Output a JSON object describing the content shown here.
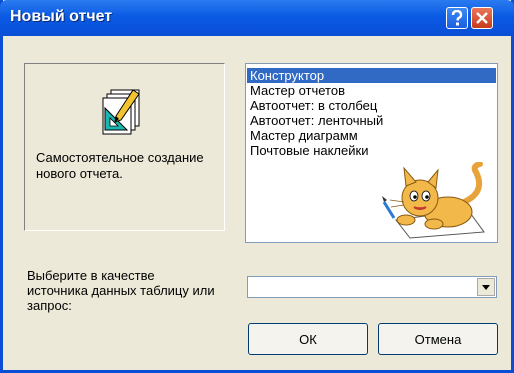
{
  "window": {
    "title": "Новый отчет"
  },
  "preview": {
    "description": "Самостоятельное создание нового отчета."
  },
  "list": {
    "items": [
      {
        "label": "Конструктор",
        "selected": true
      },
      {
        "label": "Мастер отчетов",
        "selected": false
      },
      {
        "label": "Автоотчет: в столбец",
        "selected": false
      },
      {
        "label": "Автоотчет: ленточный",
        "selected": false
      },
      {
        "label": "Мастер диаграмм",
        "selected": false
      },
      {
        "label": "Почтовые наклейки",
        "selected": false
      }
    ]
  },
  "source": {
    "label": "Выберите в качестве источника данных таблицу или запрос:",
    "value": ""
  },
  "buttons": {
    "ok": "ОК",
    "cancel": "Отмена"
  },
  "icons": [
    "help-icon",
    "close-icon",
    "wizard-icon",
    "cat-mascot-icon",
    "dropdown-arrow-icon"
  ],
  "colors": {
    "titlebar": "#0a4ed6",
    "selection": "#316ac5",
    "face": "#ece9d8"
  }
}
